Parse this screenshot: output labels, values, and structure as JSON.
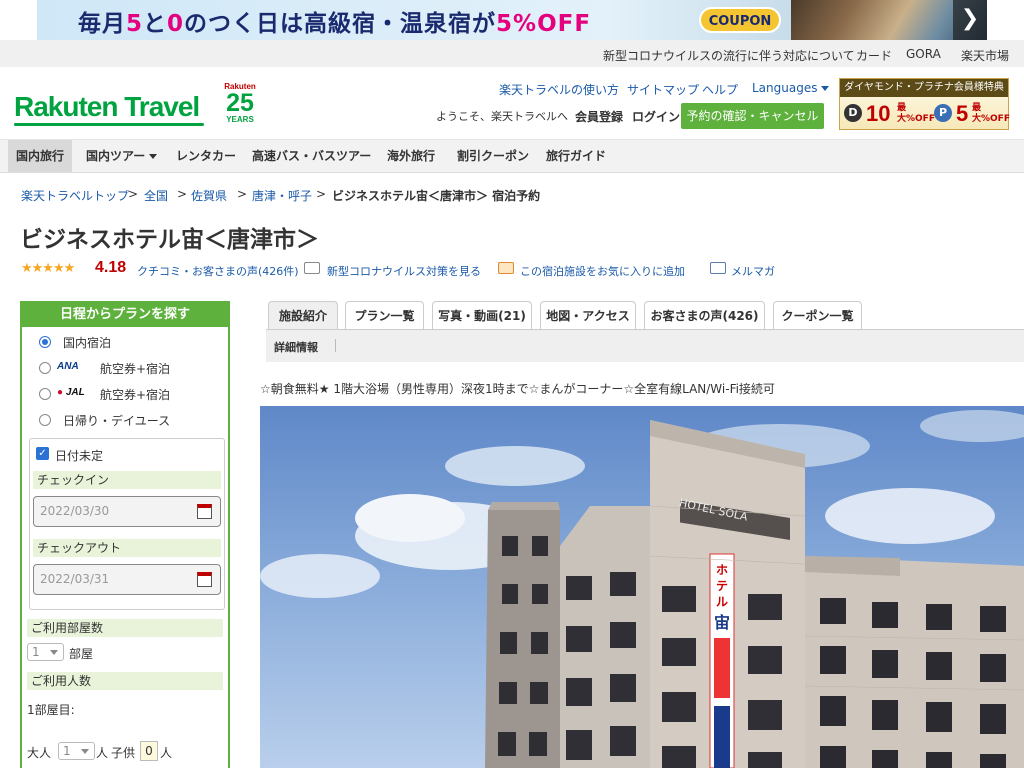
{
  "banner": {
    "text_pre": "毎月",
    "num_a": "5",
    "text_to": "と",
    "num_b": "0",
    "text_mid": "のつく日は高級宿・温泉宿が",
    "discount": "5%OFF",
    "coupon": "COUPON",
    "next": "❯"
  },
  "top_links": [
    "新型コロナウイルスの流行に伴う対応について",
    "カード",
    "GORA",
    "楽天市場"
  ],
  "header": {
    "logo": "Rakuten Travel",
    "years_brand": "Rakuten",
    "years_num": "25",
    "years_label": "YEARS",
    "links": [
      "楽天トラベルの使い方",
      "サイトマップ",
      "ヘルプ",
      "Languages"
    ],
    "welcome": "ようこそ、楽天トラベルへ",
    "register": "会員登録",
    "login": "ログイン",
    "reservation_button": "予約の確認・キャンセル",
    "diamond": {
      "title": "ダイヤモンド・プラチナ会員様特典",
      "badge1_icon": "D",
      "badge1_pct": "10",
      "badge1_off": "最大%OFF",
      "badge2_icon": "P",
      "badge2_pct": "5",
      "badge2_off": "最大%OFF"
    }
  },
  "nav": [
    "国内旅行",
    "国内ツアー",
    "レンタカー",
    "高速バス・バスツアー",
    "海外旅行",
    "割引クーポン",
    "旅行ガイド"
  ],
  "breadcrumb": {
    "items": [
      "楽天トラベルトップ",
      "全国",
      "佐賀県",
      "唐津・呼子"
    ],
    "separator": ">",
    "current": "ビジネスホテル宙＜唐津市＞ 宿泊予約"
  },
  "hotel": {
    "name": "ビジネスホテル宙＜唐津市＞",
    "stars": "★★★★★",
    "rating": "4.18",
    "review_link": "クチコミ・お客さまの声(426件)",
    "covid_link": "新型コロナウイルス対策を見る",
    "favorite_link": "この宿泊施設をお気に入りに追加",
    "mailmag_link": "メルマガ",
    "catch_copy": "☆朝食無料★ 1階大浴場（男性専用）深夜1時まで☆まんがコーナー☆全室有線LAN/Wi-Fi接続可",
    "sign_vertical": "ホテル宙"
  },
  "sidebar": {
    "title": "日程からプランを探す",
    "options": [
      "国内宿泊",
      "航空券+宿泊",
      "航空券+宿泊",
      "日帰り・デイユース"
    ],
    "ana": "ANA",
    "jal": "JAL",
    "undecided": "日付未定",
    "checkin_label": "チェックイン",
    "checkin_value": "2022/03/30",
    "checkout_label": "チェックアウト",
    "checkout_value": "2022/03/31",
    "rooms_label": "ご利用部屋数",
    "rooms_value": "1",
    "rooms_unit": "部屋",
    "people_label": "ご利用人数",
    "room1": "1部屋目:",
    "adult": "大人",
    "adult_value": "1",
    "adult_unit": "人",
    "child": "子供",
    "child_value": "0",
    "child_unit": "人"
  },
  "tabs": [
    "施設紹介",
    "プラン一覧",
    "写真・動画(21)",
    "地図・アクセス",
    "お客さまの声(426)",
    "クーポン一覧"
  ],
  "subtab": "詳細情報"
}
